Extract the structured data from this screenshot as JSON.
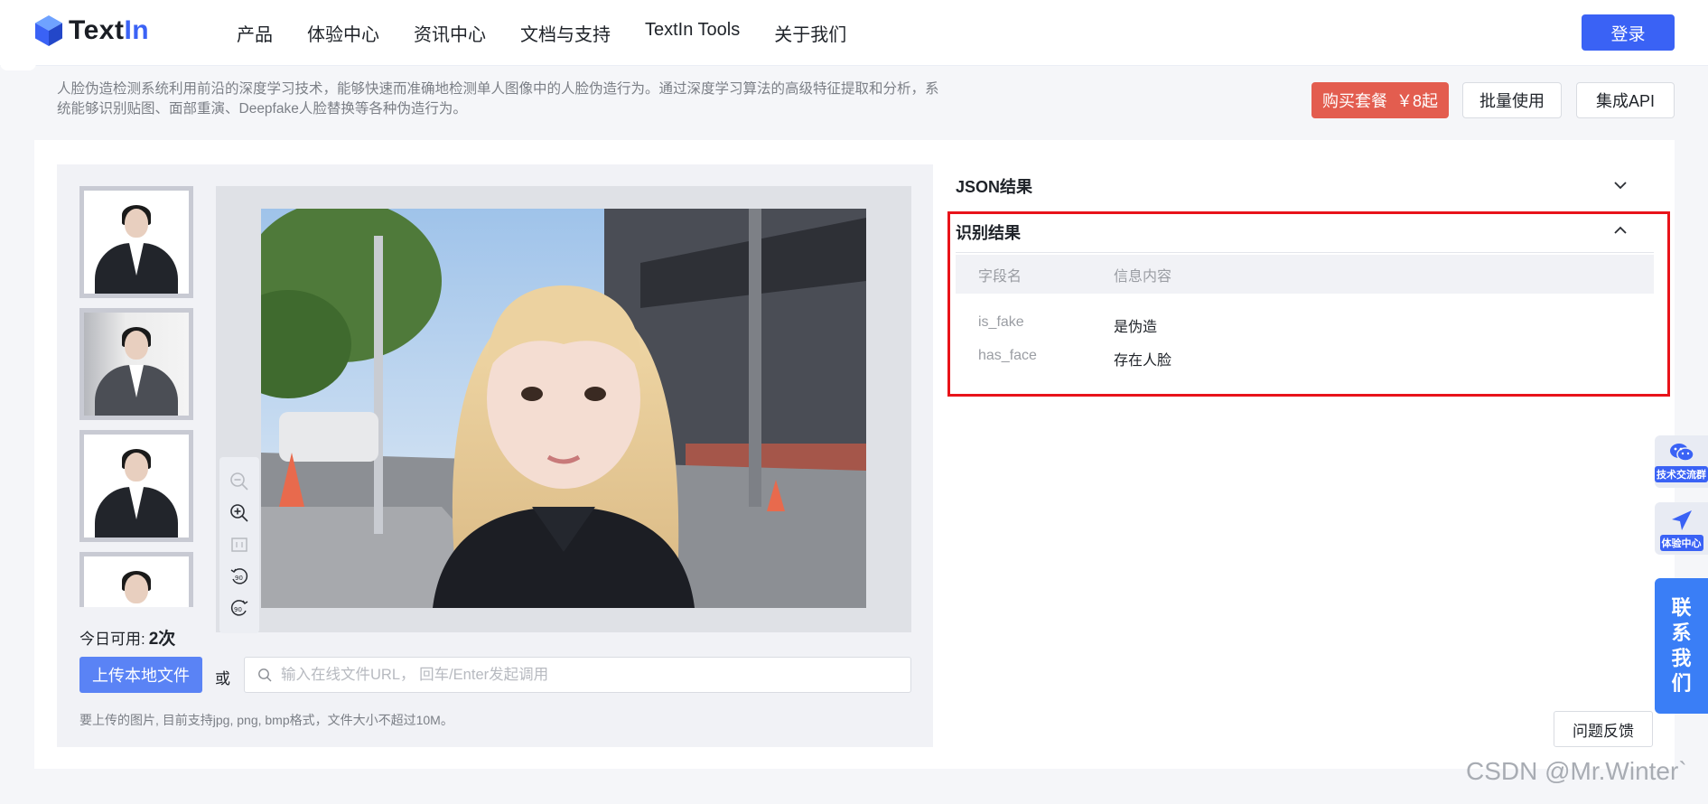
{
  "header": {
    "logo_text_a": "Text",
    "logo_text_b": "In",
    "nav": [
      "产品",
      "体验中心",
      "资讯中心",
      "文档与支持",
      "TextIn Tools",
      "关于我们"
    ],
    "login_label": "登录"
  },
  "intro": {
    "description": "人脸伪造检测系统利用前沿的深度学习技术，能够快速而准确地检测单人图像中的人脸伪造行为。通过深度学习算法的高级特征提取和分析，系统能够识别贴图、面部重演、Deepfake人脸替换等各种伪造行为。",
    "buy_label": "购买套餐",
    "buy_price": "￥8起",
    "batch_label": "批量使用",
    "api_label": "集成API"
  },
  "workspace": {
    "quota_label": "今日可用:",
    "quota_value": "2次",
    "upload_label": "上传本地文件",
    "or_label": "或",
    "url_placeholder": "输入在线文件URL， 回车/Enter发起调用",
    "hint": "要上传的图片, 目前支持jpg, png, bmp格式，文件大小不超过10M。"
  },
  "results": {
    "json_title": "JSON结果",
    "recognition_title": "识别结果",
    "col_field": "字段名",
    "col_info": "信息内容",
    "rows": [
      {
        "key": "is_fake",
        "value": "是伪造"
      },
      {
        "key": "has_face",
        "value": "存在人脸"
      }
    ]
  },
  "feedback_label": "问题反馈",
  "side": {
    "tech_group": "技术交流群",
    "exp_center": "体验中心",
    "contact": [
      "联",
      "系",
      "我",
      "们"
    ]
  },
  "watermark": "CSDN @Mr.Winter`",
  "colors": {
    "brand_blue": "#3a62f5",
    "buy_red": "#e35d4f",
    "highlight_red": "#e8131a"
  }
}
